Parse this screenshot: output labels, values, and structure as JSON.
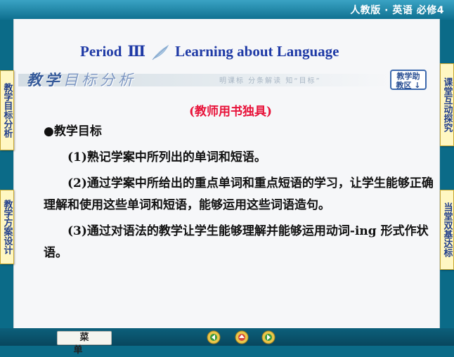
{
  "header": {
    "book_title": "人教版 · 英语  必修4"
  },
  "lesson": {
    "period_prefix": "Period",
    "period_number": "Ⅲ",
    "period_title": "Learning about Language"
  },
  "section": {
    "title_strong": "教学",
    "title_light": "目标分析",
    "motto": "明课标  分条解读  知“目标”",
    "help_button_line1": "教学助",
    "help_button_line2": "教区 ↓"
  },
  "note": "(教师用书独具)",
  "content": {
    "heading": "●教学目标",
    "items": [
      "(1)熟记学案中所列出的单词和短语。",
      "(2)通过学案中所给出的重点单词和重点短语的学习，让学生能够正确理解和使用这些单词和短语，能够运用这些词语造句。",
      "(3)通过对语法的教学让学生能够理解并能够运用动词-ing 形式作状语。"
    ]
  },
  "side_tabs": {
    "left_top": "教学目标分析",
    "left_bottom": "教学方案设计",
    "right_top": "课堂互动探究",
    "right_bottom": "当堂双基达标"
  },
  "footer": {
    "menu_label": "菜单"
  },
  "colors": {
    "frame": "#0b6b88",
    "period_title": "#1f3aa6",
    "note": "#e8133a",
    "tab_bg": "#fff7c2"
  }
}
